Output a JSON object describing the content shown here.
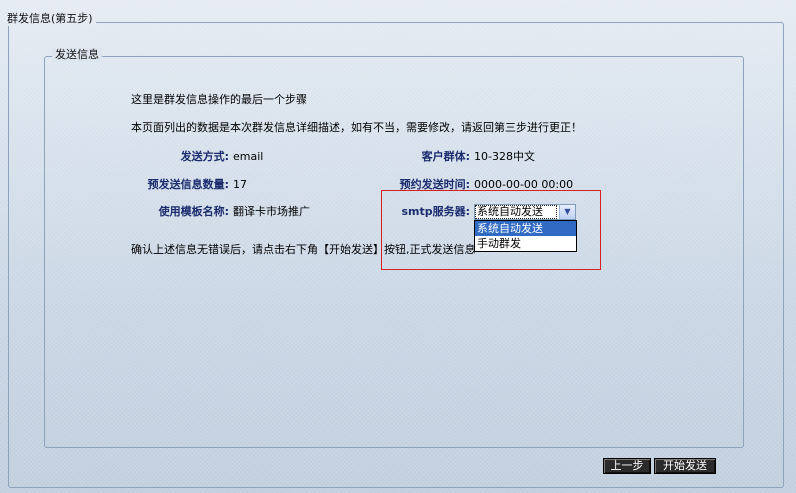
{
  "outer_legend": "群发信息(第五步)",
  "inner_legend": "发送信息",
  "intro_line1": "这里是群发信息操作的最后一个步骤",
  "intro_line2": "本页面列出的数据是本次群发信息详细描述，如有不当，需要修改，请返回第三步进行更正！",
  "send_method": {
    "label": "发送方式:",
    "value": "email"
  },
  "customer_group": {
    "label": "客户群体:",
    "value": "10-328中文"
  },
  "expected_count": {
    "label": "预发送信息数量:",
    "value": "17"
  },
  "scheduled_time": {
    "label": "预约发送时间:",
    "value": "0000-00-00 00:00"
  },
  "template_name": {
    "label": "使用模板名称:",
    "value": "翻译卡市场推广"
  },
  "smtp": {
    "label": "smtp服务器:",
    "selected": "系统自动发送",
    "options": [
      "系统自动发送",
      "手动群发"
    ]
  },
  "confirm_text": "确认上述信息无错误后，请点击右下角【开始发送】按钮,正式发送信息",
  "buttons": {
    "prev": "上一步",
    "start": "开始发送"
  }
}
